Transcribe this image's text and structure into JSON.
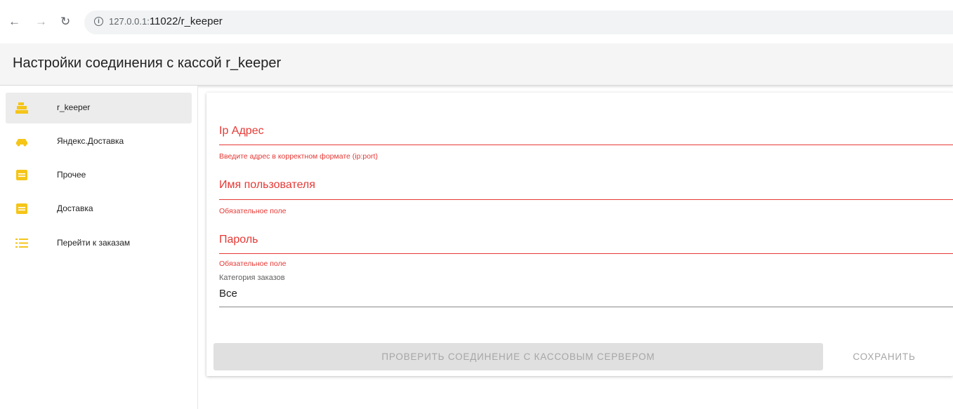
{
  "browser": {
    "url_host": "127.0.0.1:",
    "url_path": "11022/r_keeper"
  },
  "appbar": {
    "title": "Настройки соединения с кассой r_keeper"
  },
  "sidebar": {
    "items": [
      {
        "label": "r_keeper",
        "icon": "cash-register-icon",
        "active": true
      },
      {
        "label": "Яндекс.Доставка",
        "icon": "car-icon",
        "active": false
      },
      {
        "label": "Прочее",
        "icon": "message-icon",
        "active": false
      },
      {
        "label": "Доставка",
        "icon": "message-icon",
        "active": false
      },
      {
        "label": "Перейти к заказам",
        "icon": "list-icon",
        "active": false
      }
    ]
  },
  "form": {
    "ip": {
      "label": "Ip Адрес",
      "error": "Введите адрес в корректном формате (ip:port)"
    },
    "username": {
      "label": "Имя пользователя",
      "error": "Обязательное поле"
    },
    "password": {
      "label": "Пароль",
      "error": "Обязательное поле"
    },
    "category": {
      "label": "Категория заказов",
      "value": "Все"
    },
    "check_button": "ПРОВЕРИТЬ СОЕДИНЕНИЕ С КАССОВЫМ СЕРВЕРОМ",
    "save_button": "СОХРАНИТЬ"
  },
  "colors": {
    "accent_icon": "#f5c518",
    "error": "#e53935",
    "disabled_text": "#a6a6a6"
  }
}
